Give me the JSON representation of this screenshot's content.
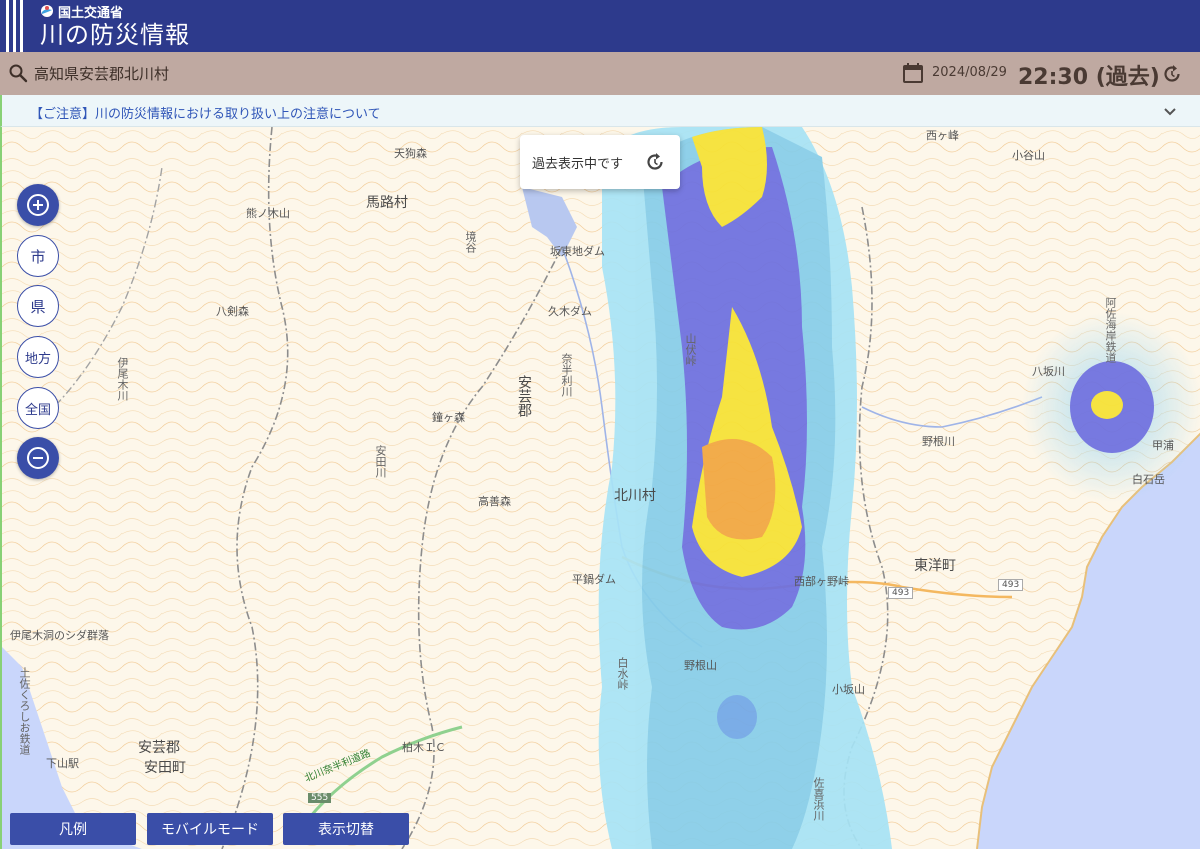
{
  "header": {
    "ministry": "国土交通省",
    "title": "川の防災情報"
  },
  "locbar": {
    "location": "高知県安芸郡北川村",
    "date": "2024/08/29",
    "time": "22:30 (過去)"
  },
  "notice": {
    "text": "【ご注意】川の防災情報における取り扱い上の注意について"
  },
  "map": {
    "past_indicator": "過去表示中です",
    "zoom_buttons": {
      "city": "市",
      "pref": "県",
      "region": "地方",
      "national": "全国"
    },
    "labels": {
      "umajimura": "馬路村",
      "tenguyamori": "天狗森",
      "kumanokiyama": "熊ノ木山",
      "yatsurugimori": "八剣森",
      "kotanidam": "坂東地ダム",
      "kukidam": "久木ダム",
      "aki_gun_center": "安芸郡",
      "kitagawamura": "北川村",
      "takazenmori": "高善森",
      "kakegamori": "鐘ヶ森",
      "hirananedam": "平鍋ダム",
      "iozurasida": "伊尾木洞のシダ群落",
      "aki_gun_sw": "安芸郡",
      "yasudacho": "安田町",
      "shimoyama": "下山駅",
      "toyocho": "東洋町",
      "nishiharayama": "西ヶ峰",
      "koyasuyama": "小谷山",
      "kokeyama": "小坂山",
      "nodoyama": "野根山",
      "nonegawa": "野根川",
      "yunokawa": "八坂川",
      "kannoura": "甲浦",
      "kashiwagi_ic": "柏木ＩＣ",
      "kitagawa_road": "北川奈半利道路",
      "road_555": "555",
      "road_493a": "493",
      "road_493b": "493",
      "shiraishidake": "白石岳",
      "nishibahoge": "西部ヶ野峠"
    },
    "vertical_labels": {
      "naharigawa": "奈半利川",
      "yasudagawa": "安田川",
      "ioki": "伊尾木川",
      "sakazaki": "境谷",
      "yamabushi": "山伏峠",
      "shioragawa": "佐喜浜川",
      "kannorailway": "阿佐海岸鉄道",
      "tosa": "土佐くろしお鉄道",
      "shiromizu": "白水峠"
    }
  },
  "bottom_buttons": {
    "legend": "凡例",
    "mobile": "モバイルモード",
    "display_switch": "表示切替"
  },
  "colors": {
    "header_bg": "#2d3a8c",
    "locbar_bg": "#bfa9a1",
    "accent": "#3a4ea8",
    "notice_text": "#3056b8",
    "map_bg": "#fdf7ea",
    "sea": "#c9d6fb"
  }
}
